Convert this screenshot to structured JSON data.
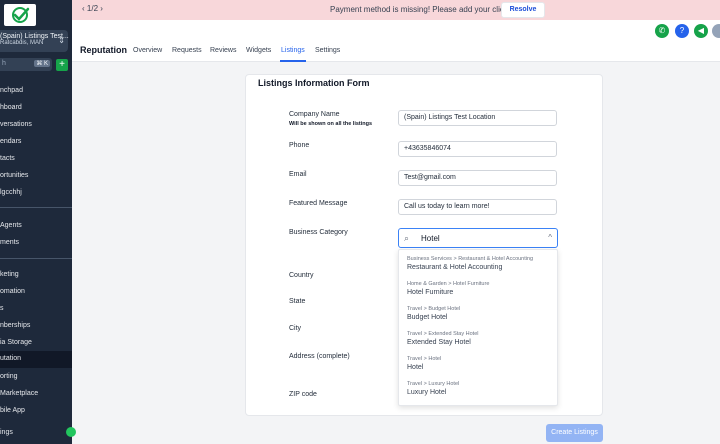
{
  "sidebar": {
    "location_name": "(Spain) Listings Test...",
    "location_sub": "Ratcabdis, MAN",
    "search_placeholder": "h",
    "search_shortcut": "⌘ K",
    "items": [
      {
        "label": "nchpad",
        "active": false
      },
      {
        "label": "hboard",
        "active": false
      },
      {
        "label": "versations",
        "active": false
      },
      {
        "label": "endars",
        "active": false
      },
      {
        "label": "tacts",
        "active": false
      },
      {
        "label": "ortunities",
        "active": false
      },
      {
        "label": "lgcchhj",
        "active": false
      },
      {
        "label": "Agents",
        "active": false
      },
      {
        "label": "ments",
        "active": false
      },
      {
        "label": "keting",
        "active": false
      },
      {
        "label": "omation",
        "active": false
      },
      {
        "label": "s",
        "active": false
      },
      {
        "label": "nberships",
        "active": false
      },
      {
        "label": "ia Storage",
        "active": false
      },
      {
        "label": "utation",
        "active": true
      },
      {
        "label": "orting",
        "active": false
      },
      {
        "label": "Marketplace",
        "active": false
      },
      {
        "label": "bile App",
        "active": false
      },
      {
        "label": "ings",
        "active": false
      }
    ]
  },
  "banner": {
    "pager": "1/2",
    "message": "Payment method is missing! Please add your client's card.",
    "resolve_label": "Resolve"
  },
  "header": {
    "title": "Reputation",
    "tabs": [
      {
        "label": "Overview",
        "active": false
      },
      {
        "label": "Requests",
        "active": false
      },
      {
        "label": "Reviews",
        "active": false
      },
      {
        "label": "Widgets",
        "active": false
      },
      {
        "label": "Listings",
        "active": true
      },
      {
        "label": "Settings",
        "active": false
      }
    ]
  },
  "form": {
    "title": "Listings Information Form",
    "company_name_label": "Company Name",
    "company_name_sub": "Will be shown on all the listings",
    "company_name_value": "(Spain) Listings Test Location",
    "phone_label": "Phone",
    "phone_value": "+43635846074",
    "email_label": "Email",
    "email_value": "Test@gmail.com",
    "featured_label": "Featured Message",
    "featured_value": "Call us today to learn more!",
    "category_label": "Business Category",
    "category_search": "Hotel",
    "country_label": "Country",
    "state_label": "State",
    "city_label": "City",
    "address_label": "Address (complete)",
    "zip_label": "ZIP code",
    "create_label": "Create Listings"
  },
  "dropdown_options": [
    {
      "path": "Business Services > Restaurant & Hotel Accounting",
      "name": "Restaurant & Hotel Accounting"
    },
    {
      "path": "Home & Garden > Hotel Furniture",
      "name": "Hotel Furniture"
    },
    {
      "path": "Travel > Budget Hotel",
      "name": "Budget Hotel"
    },
    {
      "path": "Travel > Extended Stay Hotel",
      "name": "Extended Stay Hotel"
    },
    {
      "path": "Travel > Hotel",
      "name": "Hotel"
    },
    {
      "path": "Travel > Luxury Hotel",
      "name": "Luxury Hotel"
    }
  ],
  "colors": {
    "accent": "#2563eb",
    "sidebar_bg": "#1e293b",
    "banner_bg": "#f8d7da",
    "phone_icon": "#16a34a",
    "help_icon": "#2563eb",
    "megaphone_icon": "#16a34a",
    "bell_icon": "#2563eb"
  },
  "icons": [
    "check-logo-icon",
    "chevron-left-icon",
    "chevron-right-icon",
    "phone-icon",
    "help-icon",
    "megaphone-icon",
    "bell-icon",
    "search-icon",
    "chevron-up-icon"
  ]
}
